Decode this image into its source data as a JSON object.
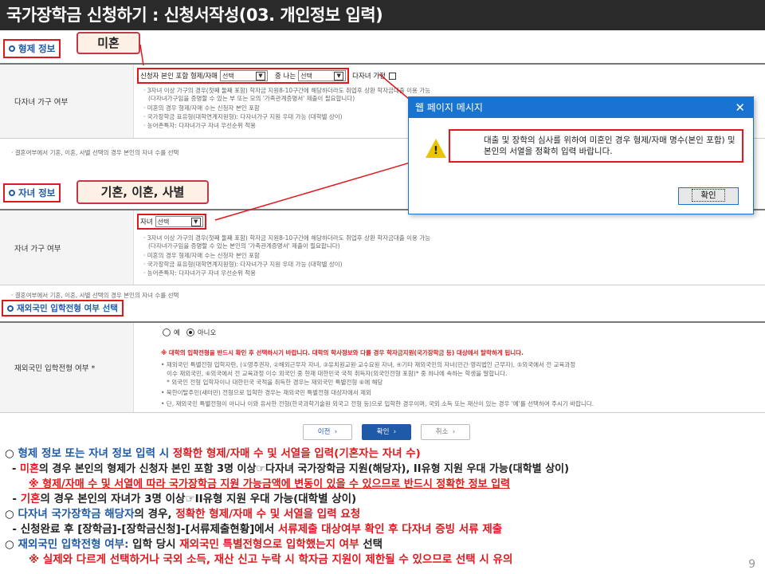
{
  "header": {
    "title": "국가장학금 신청하기 : 신청서작성(03. 개인정보 입력)"
  },
  "sibling_section": {
    "title": "형제 정보",
    "callout": "미혼",
    "row_label": "다자녀 가구 여부",
    "select_label_1": "신청자 본인 포함 형제/자매",
    "select_value_1": "선택",
    "middle_label": "중 나는",
    "select_value_2": "선택",
    "checkbox_label": "다자녀 가정",
    "bullets": [
      "3자녀 이상 가구의 경우(첫째 둘째 포함) 학자금 지원8-10구간에 해당하더라도 취업후 상환 학자금대출 이용 가능",
      "(다자녀가구임을 증명할 수 있는 부 또는 모의 '가족관계증명서' 제출이 필요합니다)",
      "미혼의 경우 형제/자매 수는 신청자 본인 포함",
      "국가장학금 표유형(대학연계지원형): 다자녀가구 지원 우대 가능 (대학별 상이)",
      "농어촌특자: 다자녀가구 자녀 우선순위 적용"
    ],
    "note": "결혼여부에서 기혼, 이혼, 사별 선택의 경우 본인의 자녀 수를 선택"
  },
  "child_section": {
    "title": "자녀 정보",
    "callout": "기혼, 이혼, 사별",
    "row_label": "자녀 가구 여부",
    "select_label": "자녀",
    "select_value": "선택",
    "bullets": [
      "3자녀 이상 가구의 경우(첫째 둘째 포함) 학자금 지원8-10구간에 해당하더라도 취업후 상환 학자금대출 이용 가능",
      "(다자녀가구임을 증명할 수 있는 본인의 '가족관계증명서' 제출이 필요합니다)",
      "미혼의 경우 형제/자매 수는 신청자 본인 포함",
      "국가장학금 표유형(대학연계지원형): 다자녀가구 지원 우대 가능 (대학별 상이)",
      "농어촌특자: 다자녀가구 자녀 우선순위 적용"
    ],
    "note": "결혼여부에서 기혼, 이혼, 사별 선택의 경우 본인의 자녀 수를 선택"
  },
  "overseas_section": {
    "title": "재외국민 입학전형 여부 선택",
    "row_label": "재외국민 입학전형 여부 *",
    "radio_yes": "예",
    "radio_no": "아니오",
    "warning": "※ 대학의 입학전형을 반드시 확인 후 선택하시기 바랍니다. 대학의 학사정보와 다를 경우 학자금지원(국가장학금 등) 대상에서 탈락하게 됩니다.",
    "bullets": [
      "• 재외국민 특별전형 입학자란, (①영주권자, ②해외근무자 자녀, ③유치원교원·교수요원 자녀, ④기타 재외국민의 자녀(민간·영리법인 근무자), ⑤외국에서 전 교육과정",
      "   이수 재외국민, ⑥외국에서 전 교육과정 이수 외국인 중 현재 대한민국 국적 취득자(외국인전형 포함)* 중 하나에 속하는 학생을 말합니다.",
      "   * 외국인 전형 입학자이나 대한민국 국적을 취득한 경우는 재외국민 특별전형 ⑥에 해당",
      "• 북한이탈주민(새터민) 전형으로 입학한 경우는 재외국민 특별전형 대상자에서 제외",
      "• 단, 재외국민 특별전형이 아니나 이와 유사한 전형(한국과학기술원 외국고 전형 등)으로 입학한 경우이며, 국외 소득 또는 재산이 있는 경우 '예'를 선택하여 주시기 바랍니다."
    ]
  },
  "dialog": {
    "title": "웹 페이지 메시지",
    "close": "✕",
    "message": "대출 및 장학의 심사를 위하여 미혼인 경우 형제/자매 명수(본인 포함) 및 본인의 서열을 정확히 입력 바랍니다.",
    "ok_label": "확인"
  },
  "nav": {
    "prev": "이전",
    "ok": "확인",
    "cancel": "취소"
  },
  "summary": {
    "l1a": "○ ",
    "l1b": "형제 정보 또는 자녀 정보 입력 시 ",
    "l1c": "정확한 형제/자매 수 및 서열을 입력(기혼자는 자녀 수)",
    "l2a": "  - ",
    "l2b": "미혼",
    "l2c": "의 경우 본인의 형제가 신청자 본인 포함 3명 이상☞다자녀 국가장학금 지원(해당자), II유형 지원 우대 가능(대학별 상이)",
    "l3": "※ 형제/자매 수 및 서열에 따라 국가장학금 지원 가능금액에 변동이 있을 수 있으므로 반드시 정확한 정보 입력",
    "l4a": "  - ",
    "l4b": "기혼",
    "l4c": "의 경우 본인의 자녀가 3명 이상☞II유형 지원 우대 가능(대학별 상이)",
    "l5a": "○ ",
    "l5b": "다자녀 국가장학금 해당자",
    "l5c": "의 경우, ",
    "l5d": "정확한 형제/자매 수 및 서열을 입력 요청",
    "l6a": "  - 신청완료 후 [장학금]-[장학금신청]-[서류제출현황]에서 ",
    "l6b": "서류제출 대상여부 확인 후 다자녀 증빙 서류 제출",
    "l7a": "○ ",
    "l7b": "재외국민 입학전형 여부:",
    "l7c": " 입학 당시 ",
    "l7d": "재외국민 특별전형으로 입학했는지 여부",
    "l7e": " 선택",
    "l8": "※ 실제와 다르게 선택하거나 국외 소득, 재산 신고 누락 시 학자금 지원이 제한될 수 있으므로 선택 시 유의"
  },
  "page_number": "9",
  "colors": {
    "accent_red": "#e0191e",
    "accent_blue": "#1f5aa8",
    "dialog_blue": "#1874d0",
    "title_bg": "#2a2a2a"
  }
}
